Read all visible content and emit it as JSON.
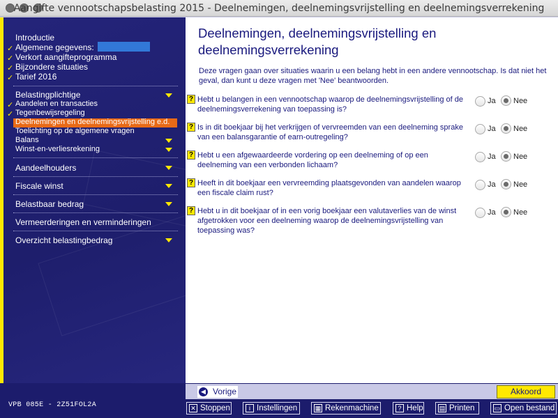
{
  "window": {
    "title": "Aangifte vennootschapsbelasting 2015 - Deelnemingen, deelnemingsvrijstelling en deelnemingsverrekening"
  },
  "sidebar": {
    "intro_items": [
      {
        "label": "Introductie",
        "checked": false
      },
      {
        "label": "Algemene gegevens:",
        "checked": true
      },
      {
        "label": "Verkort aangifteprogramma",
        "checked": true
      },
      {
        "label": "Bijzondere situaties",
        "checked": true
      },
      {
        "label": "Tarief 2016",
        "checked": true
      }
    ],
    "sections": [
      {
        "label": "Belastingplichtige"
      },
      {
        "label": "Aandelen en transacties"
      },
      {
        "label": "Tegenbewijsregeling"
      },
      {
        "label": "Deelnemingen en deelnemingsvrijstelling e.d."
      },
      {
        "label": "Toelichting op de algemene vragen"
      },
      {
        "label": "Balans"
      },
      {
        "label": "Winst-en-verliesrekening"
      }
    ],
    "groups": [
      {
        "label": "Aandeelhouders"
      },
      {
        "label": "Fiscale winst"
      },
      {
        "label": "Belastbaar bedrag"
      },
      {
        "label": "Vermeerderingen en verminderingen"
      },
      {
        "label": "Overzicht belastingbedrag"
      }
    ],
    "colors": {
      "background": "#1e1e6c",
      "accent": "#ffe800",
      "selected": "#e86a17"
    }
  },
  "main": {
    "heading": "Deelnemingen, deelnemingsvrijstelling en deelnemingsverrekening",
    "intro": "Deze vragen gaan over situaties waarin u een belang hebt in een andere vennootschap. Is dat niet het geval, dan kunt u deze vragen met 'Nee' beantwoorden.",
    "help_icon": "?",
    "options": {
      "yes": "Ja",
      "no": "Nee"
    },
    "questions": [
      {
        "text": "Hebt u belangen in een vennootschap waarop de deelnemingsvrijstelling of de deelnemingsverrekening van toepassing is?",
        "answer": "Nee"
      },
      {
        "text": "Is in dit boekjaar bij het verkrijgen of vervreemden van een deelneming sprake van een balansgarantie of earn-outregeling?",
        "answer": "Nee"
      },
      {
        "text": "Hebt u een afgewaardeerde vordering op een deelneming of op een deelneming van een verbonden lichaam?",
        "answer": "Nee"
      },
      {
        "text": "Heeft in dit boekjaar een vervreemding plaatsgevonden van aandelen waarop een fiscale claim rust?",
        "answer": "Nee"
      },
      {
        "text": "Hebt u in dit boekjaar of in een vorig boekjaar een valutaverlies van de winst afgetrokken voor een deelneming waarop de deelnemingsvrijstelling van toepassing was?",
        "answer": "Nee"
      }
    ]
  },
  "footer": {
    "back_label": "Vorige",
    "ok_label": "Akkoord",
    "version": "VPB 085E - 2Z51FOL2A",
    "toolbar": [
      {
        "label": "Stoppen",
        "icon": "close-icon"
      },
      {
        "label": "Instellingen",
        "icon": "info-icon"
      },
      {
        "label": "Rekenmachine",
        "icon": "calculator-icon"
      },
      {
        "label": "Help",
        "icon": "help-icon"
      },
      {
        "label": "Printen",
        "icon": "printer-icon"
      },
      {
        "label": "Open bestand",
        "icon": "folder-icon"
      }
    ]
  }
}
